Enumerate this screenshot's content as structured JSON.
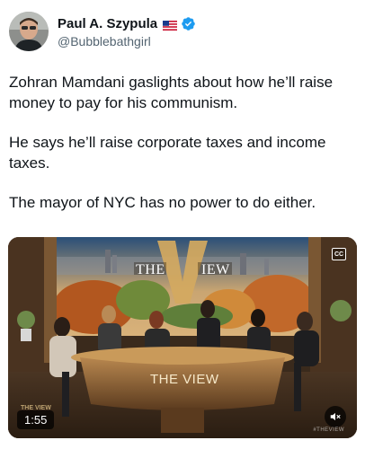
{
  "author": {
    "display_name": "Paul A. Szypula",
    "handle": "@Bubblebathgirl",
    "flag_icon": "us-flag-icon",
    "verified_icon": "verified-badge-icon",
    "verified_color": "#1d9bf0"
  },
  "post": {
    "paragraphs": [
      "Zohran Mamdani gaslights about how he’ll raise money to pay for his communism.",
      "He says he’ll raise corporate taxes and income taxes.",
      "The mayor of NYC has no power to do either."
    ]
  },
  "media": {
    "show_title_left": "THE",
    "show_title_right": "IEW",
    "desk_title": "THE VIEW",
    "duration": "1:55",
    "cc_label": "CC",
    "watermark": "#THEVIEW",
    "corner_logo": "THE VIEW",
    "mute_icon": "speaker-mute-icon"
  }
}
